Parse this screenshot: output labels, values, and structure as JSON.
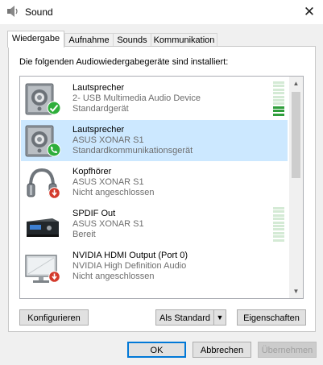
{
  "window": {
    "title": "Sound",
    "close_glyph": "✕"
  },
  "tabs": [
    {
      "label": "Wiedergabe",
      "active": true
    },
    {
      "label": "Aufnahme",
      "active": false
    },
    {
      "label": "Sounds",
      "active": false
    },
    {
      "label": "Kommunikation",
      "active": false
    }
  ],
  "intro_text": "Die folgenden Audiowiedergabegeräte sind installiert:",
  "devices": [
    {
      "name": "Lautsprecher",
      "line2": "2- USB Multimedia Audio Device",
      "line3": "Standardgerät",
      "icon": "speaker-icon",
      "badge": "green-check-badge",
      "selected": false,
      "meter": true,
      "meter_level": 0.25
    },
    {
      "name": "Lautsprecher",
      "line2": "ASUS XONAR S1",
      "line3": "Standardkommunikationsgerät",
      "icon": "speaker-icon",
      "badge": "green-phone-badge",
      "selected": true,
      "meter": false
    },
    {
      "name": "Kopfhörer",
      "line2": "ASUS XONAR S1",
      "line3": "Nicht angeschlossen",
      "icon": "headphones-icon",
      "badge": "red-unplugged-badge",
      "selected": false,
      "meter": false
    },
    {
      "name": "SPDIF Out",
      "line2": "ASUS XONAR S1",
      "line3": "Bereit",
      "icon": "spdif-device-icon",
      "badge": "",
      "selected": false,
      "meter": true,
      "meter_level": 0
    },
    {
      "name": "NVIDIA HDMI Output (Port 0)",
      "line2": "NVIDIA High Definition Audio",
      "line3": "Nicht angeschlossen",
      "icon": "monitor-icon",
      "badge": "red-unplugged-badge",
      "selected": false,
      "meter": false
    }
  ],
  "buttons": {
    "configure": "Konfigurieren",
    "set_default": "Als Standard",
    "properties": "Eigenschaften",
    "ok": "OK",
    "cancel": "Abbrechen",
    "apply": "Übernehmen"
  },
  "colors": {
    "selection": "#cce8ff",
    "accent": "#0078d7",
    "meter_idle": "#d4ead5",
    "meter_active": "#2f9e3b",
    "badge_green": "#2eae3b",
    "badge_red": "#d33a2c"
  }
}
